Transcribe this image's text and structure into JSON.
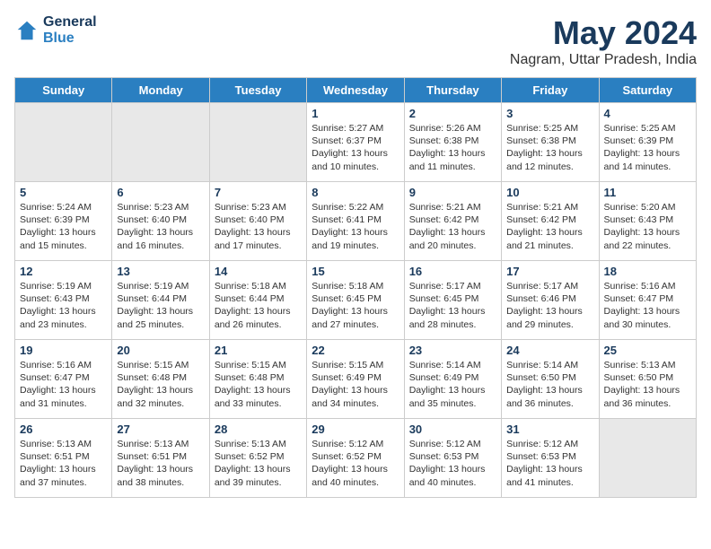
{
  "header": {
    "logo_line1": "General",
    "logo_line2": "Blue",
    "month_year": "May 2024",
    "location": "Nagram, Uttar Pradesh, India"
  },
  "days_of_week": [
    "Sunday",
    "Monday",
    "Tuesday",
    "Wednesday",
    "Thursday",
    "Friday",
    "Saturday"
  ],
  "weeks": [
    [
      {
        "day": "",
        "info": "",
        "shaded": true
      },
      {
        "day": "",
        "info": "",
        "shaded": true
      },
      {
        "day": "",
        "info": "",
        "shaded": true
      },
      {
        "day": "1",
        "info": "Sunrise: 5:27 AM\nSunset: 6:37 PM\nDaylight: 13 hours\nand 10 minutes.",
        "shaded": false
      },
      {
        "day": "2",
        "info": "Sunrise: 5:26 AM\nSunset: 6:38 PM\nDaylight: 13 hours\nand 11 minutes.",
        "shaded": false
      },
      {
        "day": "3",
        "info": "Sunrise: 5:25 AM\nSunset: 6:38 PM\nDaylight: 13 hours\nand 12 minutes.",
        "shaded": false
      },
      {
        "day": "4",
        "info": "Sunrise: 5:25 AM\nSunset: 6:39 PM\nDaylight: 13 hours\nand 14 minutes.",
        "shaded": false
      }
    ],
    [
      {
        "day": "5",
        "info": "Sunrise: 5:24 AM\nSunset: 6:39 PM\nDaylight: 13 hours\nand 15 minutes.",
        "shaded": false
      },
      {
        "day": "6",
        "info": "Sunrise: 5:23 AM\nSunset: 6:40 PM\nDaylight: 13 hours\nand 16 minutes.",
        "shaded": false
      },
      {
        "day": "7",
        "info": "Sunrise: 5:23 AM\nSunset: 6:40 PM\nDaylight: 13 hours\nand 17 minutes.",
        "shaded": false
      },
      {
        "day": "8",
        "info": "Sunrise: 5:22 AM\nSunset: 6:41 PM\nDaylight: 13 hours\nand 19 minutes.",
        "shaded": false
      },
      {
        "day": "9",
        "info": "Sunrise: 5:21 AM\nSunset: 6:42 PM\nDaylight: 13 hours\nand 20 minutes.",
        "shaded": false
      },
      {
        "day": "10",
        "info": "Sunrise: 5:21 AM\nSunset: 6:42 PM\nDaylight: 13 hours\nand 21 minutes.",
        "shaded": false
      },
      {
        "day": "11",
        "info": "Sunrise: 5:20 AM\nSunset: 6:43 PM\nDaylight: 13 hours\nand 22 minutes.",
        "shaded": false
      }
    ],
    [
      {
        "day": "12",
        "info": "Sunrise: 5:19 AM\nSunset: 6:43 PM\nDaylight: 13 hours\nand 23 minutes.",
        "shaded": false
      },
      {
        "day": "13",
        "info": "Sunrise: 5:19 AM\nSunset: 6:44 PM\nDaylight: 13 hours\nand 25 minutes.",
        "shaded": false
      },
      {
        "day": "14",
        "info": "Sunrise: 5:18 AM\nSunset: 6:44 PM\nDaylight: 13 hours\nand 26 minutes.",
        "shaded": false
      },
      {
        "day": "15",
        "info": "Sunrise: 5:18 AM\nSunset: 6:45 PM\nDaylight: 13 hours\nand 27 minutes.",
        "shaded": false
      },
      {
        "day": "16",
        "info": "Sunrise: 5:17 AM\nSunset: 6:45 PM\nDaylight: 13 hours\nand 28 minutes.",
        "shaded": false
      },
      {
        "day": "17",
        "info": "Sunrise: 5:17 AM\nSunset: 6:46 PM\nDaylight: 13 hours\nand 29 minutes.",
        "shaded": false
      },
      {
        "day": "18",
        "info": "Sunrise: 5:16 AM\nSunset: 6:47 PM\nDaylight: 13 hours\nand 30 minutes.",
        "shaded": false
      }
    ],
    [
      {
        "day": "19",
        "info": "Sunrise: 5:16 AM\nSunset: 6:47 PM\nDaylight: 13 hours\nand 31 minutes.",
        "shaded": false
      },
      {
        "day": "20",
        "info": "Sunrise: 5:15 AM\nSunset: 6:48 PM\nDaylight: 13 hours\nand 32 minutes.",
        "shaded": false
      },
      {
        "day": "21",
        "info": "Sunrise: 5:15 AM\nSunset: 6:48 PM\nDaylight: 13 hours\nand 33 minutes.",
        "shaded": false
      },
      {
        "day": "22",
        "info": "Sunrise: 5:15 AM\nSunset: 6:49 PM\nDaylight: 13 hours\nand 34 minutes.",
        "shaded": false
      },
      {
        "day": "23",
        "info": "Sunrise: 5:14 AM\nSunset: 6:49 PM\nDaylight: 13 hours\nand 35 minutes.",
        "shaded": false
      },
      {
        "day": "24",
        "info": "Sunrise: 5:14 AM\nSunset: 6:50 PM\nDaylight: 13 hours\nand 36 minutes.",
        "shaded": false
      },
      {
        "day": "25",
        "info": "Sunrise: 5:13 AM\nSunset: 6:50 PM\nDaylight: 13 hours\nand 36 minutes.",
        "shaded": false
      }
    ],
    [
      {
        "day": "26",
        "info": "Sunrise: 5:13 AM\nSunset: 6:51 PM\nDaylight: 13 hours\nand 37 minutes.",
        "shaded": false
      },
      {
        "day": "27",
        "info": "Sunrise: 5:13 AM\nSunset: 6:51 PM\nDaylight: 13 hours\nand 38 minutes.",
        "shaded": false
      },
      {
        "day": "28",
        "info": "Sunrise: 5:13 AM\nSunset: 6:52 PM\nDaylight: 13 hours\nand 39 minutes.",
        "shaded": false
      },
      {
        "day": "29",
        "info": "Sunrise: 5:12 AM\nSunset: 6:52 PM\nDaylight: 13 hours\nand 40 minutes.",
        "shaded": false
      },
      {
        "day": "30",
        "info": "Sunrise: 5:12 AM\nSunset: 6:53 PM\nDaylight: 13 hours\nand 40 minutes.",
        "shaded": false
      },
      {
        "day": "31",
        "info": "Sunrise: 5:12 AM\nSunset: 6:53 PM\nDaylight: 13 hours\nand 41 minutes.",
        "shaded": false
      },
      {
        "day": "",
        "info": "",
        "shaded": true
      }
    ]
  ]
}
